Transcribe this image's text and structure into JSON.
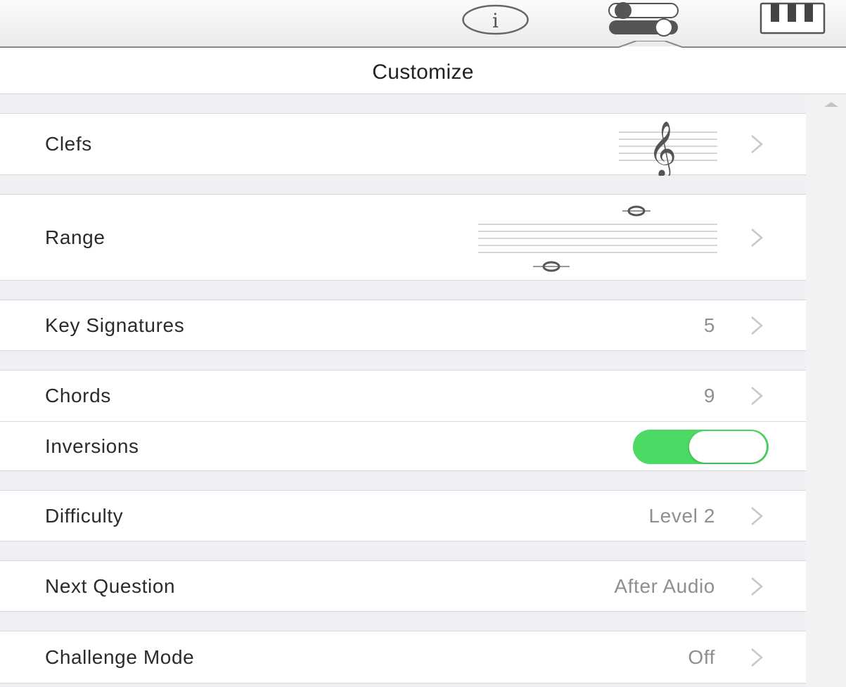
{
  "toolbar": {
    "info_icon": "info-circle-icon",
    "customize_icon": "toggles-icon",
    "piano_icon": "piano-keyboard-icon",
    "info_glyph": "i"
  },
  "panel": {
    "title": "Customize"
  },
  "rows": [
    {
      "label": "Clefs",
      "preview": "treble-clef-icon"
    },
    {
      "label": "Range",
      "preview": "range-staff-icon"
    },
    {
      "label": "Key Signatures",
      "value": "5"
    },
    {
      "label": "Chords",
      "value": "9"
    },
    {
      "label": "Inversions",
      "toggle_on": true
    },
    {
      "label": "Difficulty",
      "value": "Level 2"
    },
    {
      "label": "Next Question",
      "value": "After Audio"
    },
    {
      "label": "Challenge Mode",
      "value": "Off"
    }
  ],
  "colors": {
    "toggle_on": "#4cd964",
    "group_background": "#efeff4",
    "secondary_text": "#8e8e93"
  }
}
